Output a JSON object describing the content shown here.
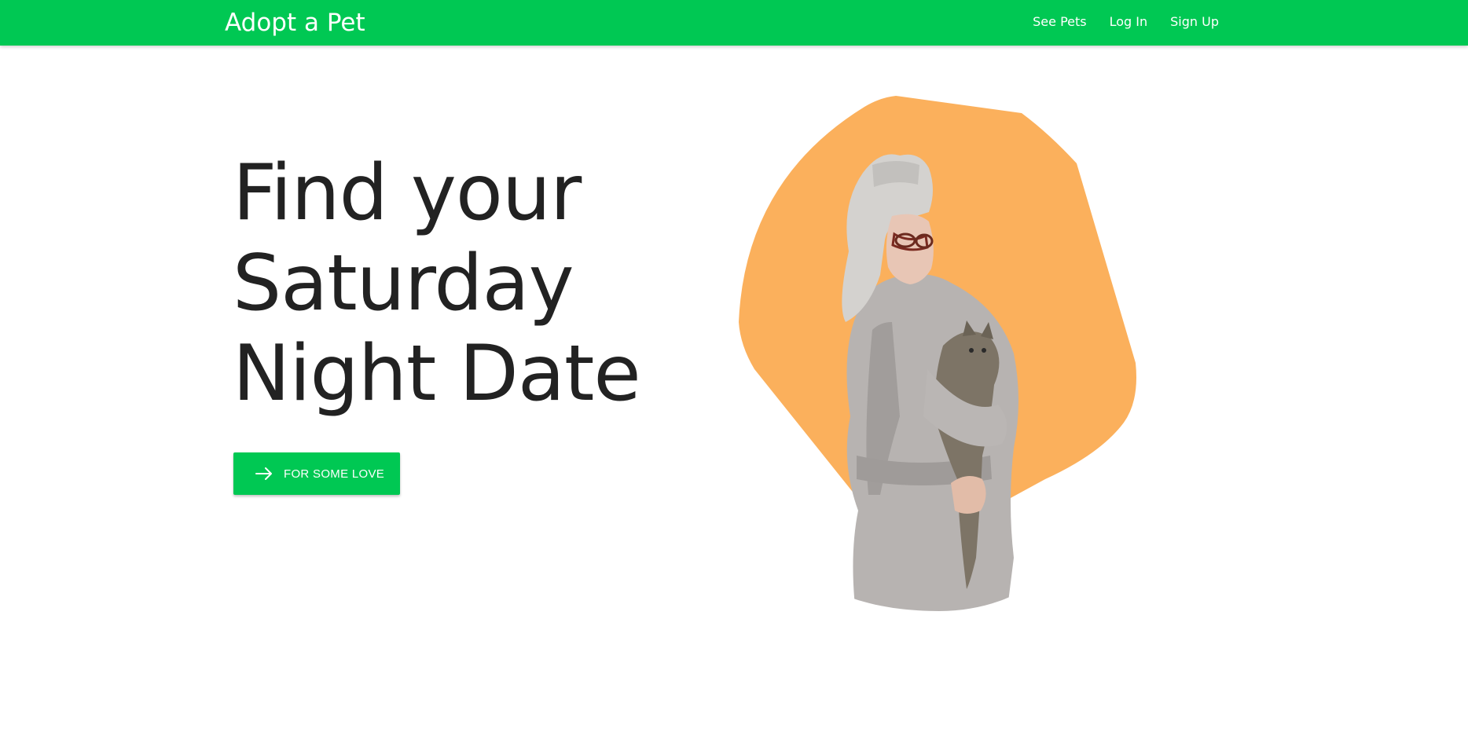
{
  "navbar": {
    "brand": "Adopt a Pet",
    "links": [
      "See Pets",
      "Log In",
      "Sign Up"
    ]
  },
  "hero": {
    "title_lines": [
      "Find your",
      "Saturday",
      "Night Date"
    ],
    "cta_label": "FOR SOME LOVE",
    "cta_icon": "arrow-right-icon"
  },
  "colors": {
    "primary": "#00c853",
    "blob": "#fbb05c",
    "title_text": "#222222"
  },
  "image": {
    "subject": "woman-with-towel-holding-cat-photo"
  }
}
